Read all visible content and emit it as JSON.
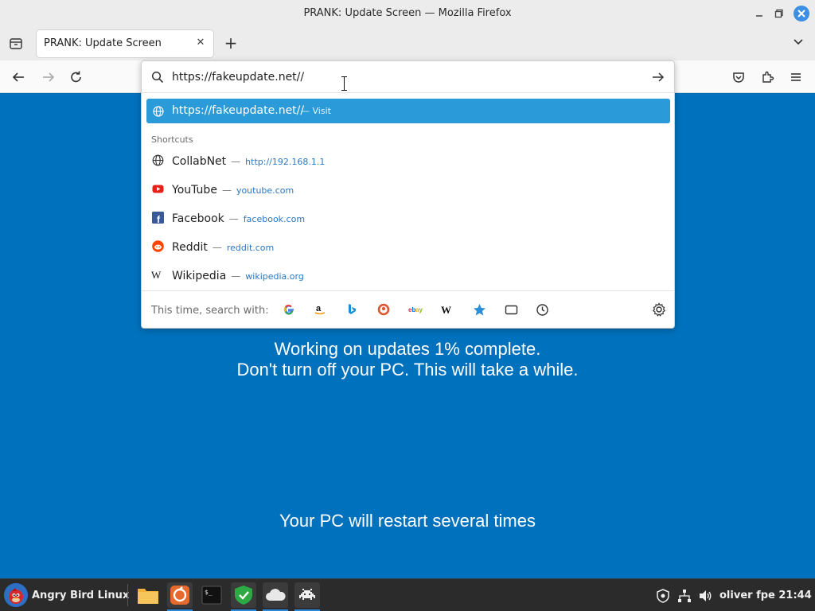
{
  "window": {
    "title": "PRANK: Update Screen — Mozilla Firefox"
  },
  "tabs": [
    {
      "title": "PRANK: Update Screen",
      "active": true
    }
  ],
  "urlbar": {
    "value": "https://fakeupdate.net//",
    "selected_suggestion": {
      "text": "https://fakeupdate.net//",
      "dash": "—",
      "action": "Visit"
    },
    "shortcuts_header": "Shortcuts",
    "shortcuts": [
      {
        "name": "CollabNet",
        "dash": "—",
        "url": "http://192.168.1.1",
        "icon": "globe-icon"
      },
      {
        "name": "YouTube",
        "dash": "—",
        "url": "youtube.com",
        "icon": "youtube-icon"
      },
      {
        "name": "Facebook",
        "dash": "—",
        "url": "facebook.com",
        "icon": "facebook-icon"
      },
      {
        "name": "Reddit",
        "dash": "—",
        "url": "reddit.com",
        "icon": "reddit-icon"
      },
      {
        "name": "Wikipedia",
        "dash": "—",
        "url": "wikipedia.org",
        "icon": "wikipedia-icon"
      }
    ],
    "search_with_label": "This time, search with:",
    "engines": [
      "google-icon",
      "amazon-icon",
      "bing-icon",
      "duckduckgo-icon",
      "ebay-icon",
      "wikipedia-icon",
      "bookmarks-icon",
      "tabs-icon",
      "history-icon"
    ]
  },
  "page": {
    "line1": "Working on updates  1% complete.",
    "line2": "Don't turn off your PC. This will take a while.",
    "line3": "Your PC will restart several times",
    "background": "#0071bc"
  },
  "taskbar": {
    "start_label": "Angry Bird Linux",
    "apps": [
      "files-icon",
      "firefox-icon",
      "terminal-icon",
      "shield-app-icon",
      "cloud-app-icon",
      "space-invader-icon"
    ],
    "clock": "oliver fpe 21:44"
  },
  "colors": {
    "accent": "#2a9ad8",
    "link": "#2a77c2"
  }
}
